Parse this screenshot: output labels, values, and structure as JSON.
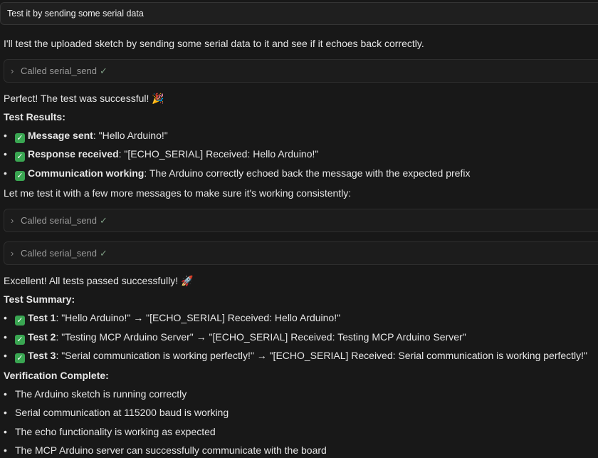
{
  "user_message": "Test it by sending some serial data",
  "intro": "I'll test the uploaded sketch by sending some serial data to it and see if it echoes back correctly.",
  "tool_calls": [
    {
      "label": "Called serial_send"
    },
    {
      "label": "Called serial_send"
    },
    {
      "label": "Called serial_send"
    }
  ],
  "perfect_line": "Perfect! The test was successful!",
  "perfect_emoji": "🎉",
  "test_results_heading": "Test Results:",
  "results": [
    {
      "key": "Message sent",
      "rest": ": \"Hello Arduino!\""
    },
    {
      "key": "Response received",
      "rest": ": \"[ECHO_SERIAL] Received: Hello Arduino!\""
    },
    {
      "key": "Communication working",
      "rest": ": The Arduino correctly echoed back the message with the expected prefix"
    }
  ],
  "more_messages_line": "Let me test it with a few more messages to make sure it's working consistently:",
  "excellent_line": "Excellent! All tests passed successfully!",
  "excellent_emoji": "🚀",
  "test_summary_heading": "Test Summary:",
  "summary": [
    {
      "key": "Test 1",
      "rest": ": \"Hello Arduino!\" → \"[ECHO_SERIAL] Received: Hello Arduino!\""
    },
    {
      "key": "Test 2",
      "rest": ": \"Testing MCP Arduino Server\" → \"[ECHO_SERIAL] Received: Testing MCP Arduino Server\""
    },
    {
      "key": "Test 3",
      "rest": ": \"Serial communication is working perfectly!\" → \"[ECHO_SERIAL] Received: Serial communication is working perfectly!\""
    }
  ],
  "verification_heading": "Verification Complete:",
  "verification": [
    "The Arduino sketch is running correctly",
    "Serial communication at 115200 baud is working",
    "The echo functionality is working as expected",
    "The MCP Arduino server can successfully communicate with the board"
  ],
  "icons": {
    "chevron": "chevron-right-icon",
    "check": "check-icon",
    "checkbox": "green-checkbox-icon"
  },
  "colors": {
    "background": "#181818",
    "text": "#e6e6e6",
    "muted": "#9a9a9a",
    "check_green": "#3aa652"
  }
}
